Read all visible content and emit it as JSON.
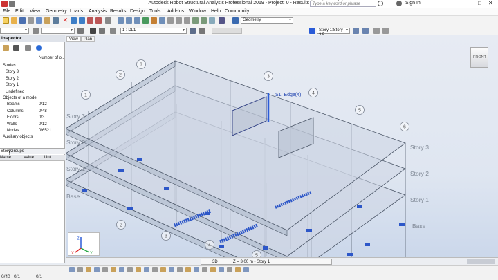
{
  "window": {
    "title": "Autodesk Robot Structural Analysis Professional 2019 - Project: 0 - Results (FEM): out of date",
    "search_placeholder": "Type a keyword or phrase",
    "sign_in": "Sign In"
  },
  "menu": [
    "File",
    "Edit",
    "View",
    "Geometry",
    "Loads",
    "Analysis",
    "Results",
    "Design",
    "Tools",
    "Add-Ins",
    "Window",
    "Help",
    "Community"
  ],
  "toolbar": {
    "layout_combo": "Geometry",
    "load_case_combo": "1 : DL1",
    "story_combo": "Story 1:Story 2:5"
  },
  "inspector": {
    "title": "Inspector",
    "column_header": "Number of o..",
    "tree": [
      {
        "label": "Stories",
        "value": ""
      },
      {
        "label": "Story 3",
        "value": ""
      },
      {
        "label": "Story 2",
        "value": ""
      },
      {
        "label": "Story 1",
        "value": ""
      },
      {
        "label": "Undefined",
        "value": ""
      },
      {
        "label": "Objects of a model",
        "value": ""
      },
      {
        "label": "Beams",
        "value": "0/12"
      },
      {
        "label": "Columns",
        "value": "0/48"
      },
      {
        "label": "Floors",
        "value": "0/3"
      },
      {
        "label": "Walls",
        "value": "0/12"
      },
      {
        "label": "Nodes",
        "value": "0/6521"
      },
      {
        "label": "Auxiliary objects",
        "value": ""
      }
    ],
    "tabs": [
      "Story",
      "Groups"
    ],
    "props_columns": [
      "Name",
      "Value",
      "Unit"
    ]
  },
  "view": {
    "tabs": [
      "View",
      "Plan"
    ],
    "selected_label": "S1_Edge(4)",
    "story_labels_left": [
      "Story 3",
      "Story 2",
      "Story 1",
      "Base"
    ],
    "story_labels_right": [
      "Story 3",
      "Story 2",
      "Story 1",
      "Base"
    ],
    "grid_axes": [
      "1",
      "2",
      "3",
      "3",
      "4",
      "5",
      "6",
      "2",
      "3",
      "4",
      "5"
    ],
    "status_mode": "3D",
    "status_z": "Z = 3,00 m - Story 1",
    "cube_label": "FRONT"
  },
  "bottom_bar": {
    "coords_left": "0/40",
    "coords_right": "0/1",
    "coords_mid": "0/1"
  },
  "colors": {
    "accent": "#2a5bd7",
    "support": "#2d57c8",
    "background_top": "#e7ebf3",
    "background_bottom": "#c9d6ea"
  }
}
